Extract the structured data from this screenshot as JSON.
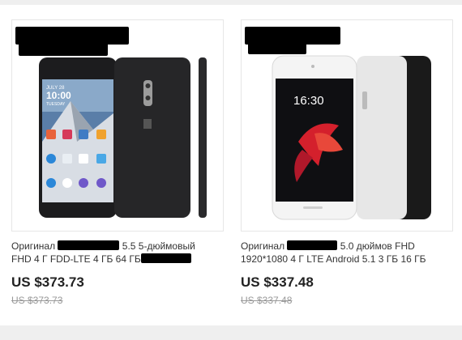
{
  "products": [
    {
      "title_prefix": "Оригинал",
      "title_line1_suffix": "5.5 5-дюймовый",
      "title_line2": "FHD 4 Г FDD-LTE 4 ГБ 64 ГБ",
      "price": "US $373.73",
      "old_price": "US $373.73",
      "screen": {
        "date": "JULY 28",
        "time": "10:00",
        "day": "TUESDAY"
      }
    },
    {
      "title_prefix": "Оригинал",
      "title_line1_suffix": "5.0 дюймов FHD",
      "title_line2": "1920*1080 4 Г LTE Android 5.1 3 ГБ 16 ГБ",
      "price": "US $337.48",
      "old_price": "US $337.48",
      "screen": {
        "time": "16:30"
      }
    }
  ],
  "colors": {
    "page_bg": "#ffffff",
    "frame_gray": "#efefef",
    "price": "#222222",
    "old_price": "#999999",
    "phone_black": "#1c1c1e",
    "phone_white": "#f2f2f2"
  }
}
